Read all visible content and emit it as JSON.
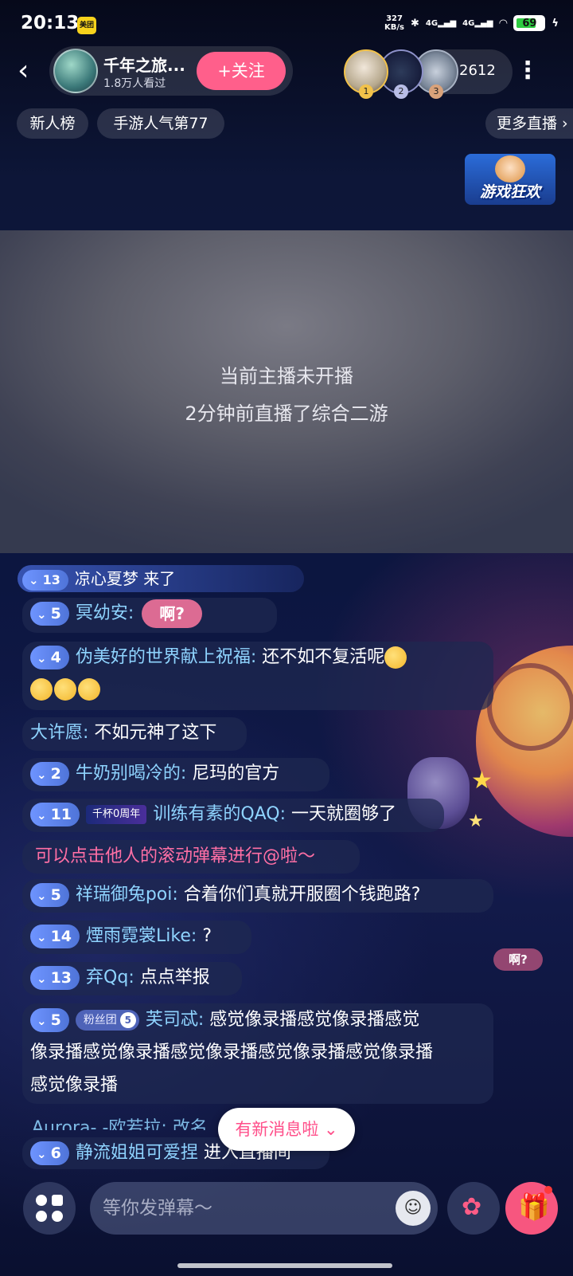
{
  "status_bar": {
    "time": "20:13",
    "app_badge": "美团",
    "net_speed_value": "327",
    "net_speed_unit": "KB/s",
    "signal_1": "4G",
    "signal_2": "4G",
    "battery": "69"
  },
  "header": {
    "anchor_name": "千年之旅...",
    "anchor_viewers": "1.8万人看过",
    "follow_label": "+关注",
    "viewer_count": "2612",
    "rank_badges": [
      "1",
      "2",
      "3"
    ]
  },
  "tags": {
    "new_rank": "新人榜",
    "game_rank": "手游人气第77",
    "more_live": "更多直播"
  },
  "event_badge": {
    "label": "游戏狂欢"
  },
  "video": {
    "status": "当前主播未开播",
    "last_live": "2分钟前直播了综合二游"
  },
  "chat": {
    "entry": {
      "level": "13",
      "name": "凉心夏梦",
      "action": "来了"
    },
    "messages": [
      {
        "level": "5",
        "user": "冥幼安:",
        "sticker": "啊?"
      },
      {
        "level": "4",
        "user": "伪美好的世界献上祝福:",
        "text": "还不如不复活呢"
      },
      {
        "user": "大许愿:",
        "text": "不如元神了这下"
      },
      {
        "level": "2",
        "user": "牛奶别喝冷的:",
        "text": "尼玛的官方"
      },
      {
        "level": "11",
        "medal": "千杯0周年",
        "user": "训练有素的QAQ:",
        "text": "一天就圈够了"
      },
      {
        "level": "5",
        "user": "祥瑞御兔poi:",
        "text": "合着你们真就开服圈个钱跑路?"
      },
      {
        "level": "14",
        "user": "煙雨霓裳Like:",
        "text": "?"
      },
      {
        "level": "13",
        "user": "弃Qq:",
        "text": "点点举报"
      },
      {
        "level": "5",
        "fanclub": "粉丝团",
        "fanclub_level": "5",
        "user": "芙司忒:",
        "text_line1": "感觉像录播感觉像录播感觉",
        "text_line2": "像录播感觉像录播感觉像录播感觉像录播感觉像录播",
        "text_line3": "感觉像录播"
      }
    ],
    "tip": "可以点击他人的滚动弹幕进行@啦～",
    "partial": "Aurora- -欧若拉: 改名",
    "bottom_entry": {
      "level": "6",
      "name": "静流姐姐可爱捏",
      "action": "进入直播间"
    },
    "new_messages": "有新消息啦",
    "floating_sticker": "啊?"
  },
  "input": {
    "placeholder": "等你发弹幕～"
  },
  "colors": {
    "accent": "#ff5f8b",
    "username": "#8fd4ff",
    "tip": "#ff6fa5",
    "level_badge": "#5f86f0"
  }
}
